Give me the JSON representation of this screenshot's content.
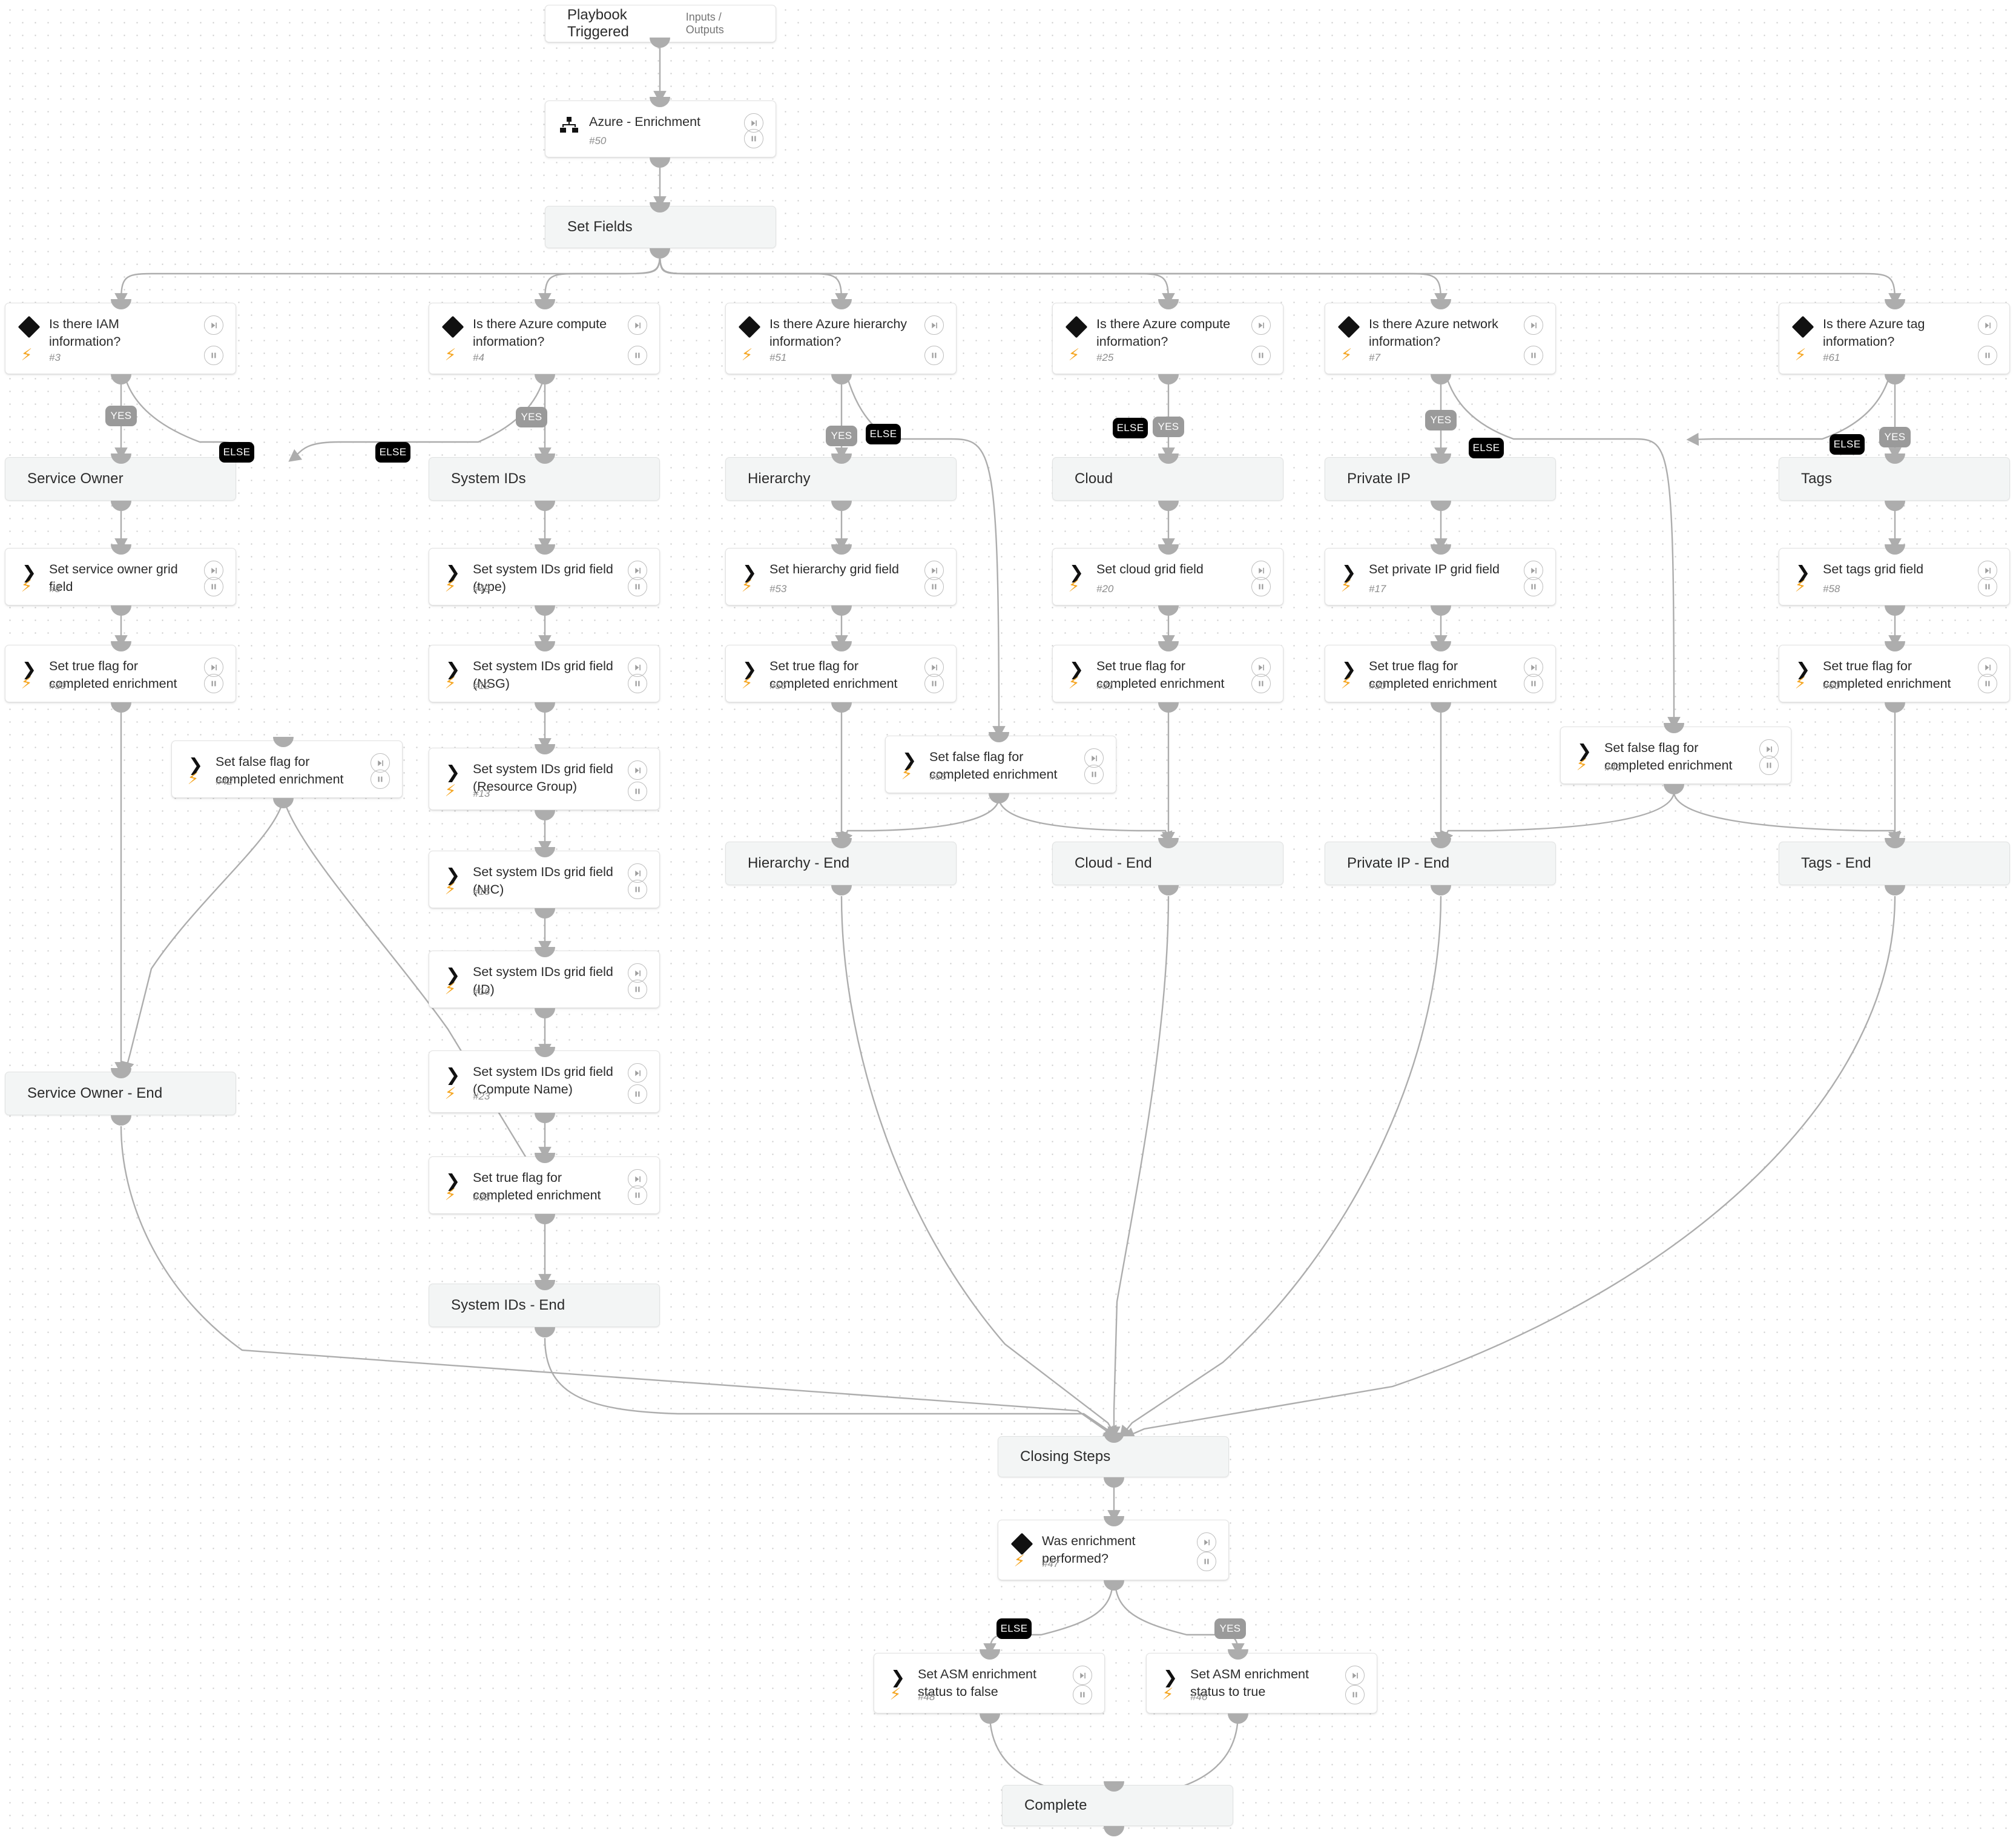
{
  "meta": {
    "view": "playbook-workflow-canvas",
    "colors": {
      "accent_bolt": "#f5a623",
      "yes_badge": "#9a9a9a",
      "else_badge": "#000000",
      "section_fill": "#f3f5f5",
      "card_fill": "#ffffff",
      "edge": "#adadad"
    }
  },
  "labels": {
    "yes": "YES",
    "else": "ELSE"
  },
  "trigger": {
    "title": "Playbook Triggered",
    "io": "Inputs / Outputs"
  },
  "nodes": [
    {
      "id": "n50",
      "kind": "subplaybook",
      "title": "Azure - Enrichment",
      "num": "#50"
    },
    {
      "id": "s_setfields",
      "kind": "section",
      "title": "Set Fields"
    },
    {
      "id": "n3",
      "kind": "condition",
      "title": "Is there IAM information?",
      "num": "#3"
    },
    {
      "id": "n4",
      "kind": "condition",
      "title": "Is there Azure compute information?",
      "num": "#4"
    },
    {
      "id": "n51",
      "kind": "condition",
      "title": "Is there Azure hierarchy information?",
      "num": "#51"
    },
    {
      "id": "n25",
      "kind": "condition",
      "title": "Is there Azure compute information?",
      "num": "#25"
    },
    {
      "id": "n7",
      "kind": "condition",
      "title": "Is there Azure network information?",
      "num": "#7"
    },
    {
      "id": "n61",
      "kind": "condition",
      "title": "Is there Azure tag information?",
      "num": "#61"
    },
    {
      "id": "s_serviceowner",
      "kind": "section",
      "title": "Service Owner"
    },
    {
      "id": "s_systemids",
      "kind": "section",
      "title": "System IDs"
    },
    {
      "id": "s_hierarchy",
      "kind": "section",
      "title": "Hierarchy"
    },
    {
      "id": "s_cloud",
      "kind": "section",
      "title": "Cloud"
    },
    {
      "id": "s_privateip",
      "kind": "section",
      "title": "Private IP"
    },
    {
      "id": "s_tags",
      "kind": "section",
      "title": "Tags"
    },
    {
      "id": "n8",
      "kind": "action",
      "title": "Set service owner grid field",
      "num": "#8"
    },
    {
      "id": "n39",
      "kind": "action",
      "title": "Set true flag for completed enrichment",
      "num": "#39"
    },
    {
      "id": "n42",
      "kind": "action",
      "title": "Set false flag for completed enrichment",
      "num": "#42"
    },
    {
      "id": "n49",
      "kind": "action",
      "title": "Set system IDs grid field (type)",
      "num": "#49"
    },
    {
      "id": "n12",
      "kind": "action",
      "title": "Set system IDs grid field (NSG)",
      "num": "#12"
    },
    {
      "id": "n13",
      "kind": "action",
      "title": "Set system IDs grid field (Resource Group)",
      "num": "#13"
    },
    {
      "id": "n15",
      "kind": "action",
      "title": "Set system IDs grid field (NIC)",
      "num": "#15"
    },
    {
      "id": "n16",
      "kind": "action",
      "title": "Set system IDs grid field (ID)",
      "num": "#16"
    },
    {
      "id": "n23",
      "kind": "action",
      "title": "Set system IDs grid field (Compute Name)",
      "num": "#23"
    },
    {
      "id": "n38",
      "kind": "action",
      "title": "Set true flag for completed enrichment",
      "num": "#38"
    },
    {
      "id": "n53",
      "kind": "action",
      "title": "Set hierarchy grid field",
      "num": "#53"
    },
    {
      "id": "n56",
      "kind": "action",
      "title": "Set true flag for completed enrichment",
      "num": "#56"
    },
    {
      "id": "n55",
      "kind": "action",
      "title": "Set false flag for completed enrichment",
      "num": "#55"
    },
    {
      "id": "n20",
      "kind": "action",
      "title": "Set cloud grid field",
      "num": "#20"
    },
    {
      "id": "n31",
      "kind": "action",
      "title": "Set true flag for completed enrichment",
      "num": "#31"
    },
    {
      "id": "n17",
      "kind": "action",
      "title": "Set private IP grid field",
      "num": "#17"
    },
    {
      "id": "n30",
      "kind": "action",
      "title": "Set true flag for completed enrichment",
      "num": "#30"
    },
    {
      "id": "n43",
      "kind": "action",
      "title": "Set false flag for completed enrichment",
      "num": "#43"
    },
    {
      "id": "n58",
      "kind": "action",
      "title": "Set tags grid field",
      "num": "#58"
    },
    {
      "id": "n60",
      "kind": "action",
      "title": "Set true flag for completed enrichment",
      "num": "#60"
    },
    {
      "id": "s_so_end",
      "kind": "section",
      "title": "Service Owner - End"
    },
    {
      "id": "s_sid_end",
      "kind": "section",
      "title": "System IDs - End"
    },
    {
      "id": "s_hier_end",
      "kind": "section",
      "title": "Hierarchy - End"
    },
    {
      "id": "s_cloud_end",
      "kind": "section",
      "title": "Cloud - End"
    },
    {
      "id": "s_pip_end",
      "kind": "section",
      "title": "Private IP - End"
    },
    {
      "id": "s_tags_end",
      "kind": "section",
      "title": "Tags - End"
    },
    {
      "id": "s_closing",
      "kind": "section",
      "title": "Closing Steps"
    },
    {
      "id": "n47",
      "kind": "condition",
      "title": "Was enrichment performed?",
      "num": "#47"
    },
    {
      "id": "n48",
      "kind": "action",
      "title": "Set ASM enrichment status to false",
      "num": "#48"
    },
    {
      "id": "n46",
      "kind": "action",
      "title": "Set ASM enrichment status to true",
      "num": "#46"
    },
    {
      "id": "s_complete",
      "kind": "section",
      "title": "Complete"
    }
  ]
}
